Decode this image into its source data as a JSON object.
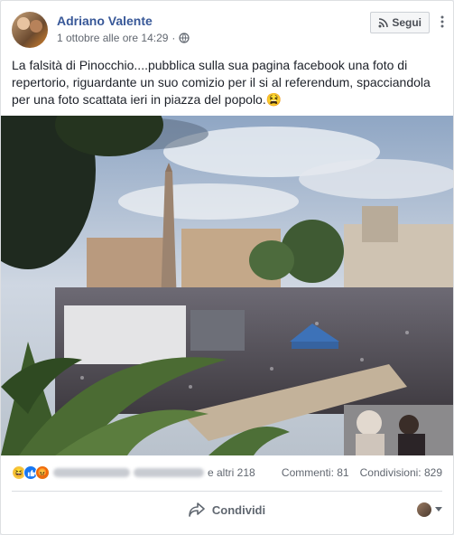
{
  "post": {
    "author": "Adriano Valente",
    "timestamp": "1 ottobre alle ore 14:29",
    "follow_label": "Segui",
    "text": "La falsità di Pinocchio....pubblica sulla sua pagina facebook una foto di repertorio, riguardante un suo comizio per il si al referendum, spacciandola per una foto scattata ieri in piazza del popolo.",
    "text_emoji": "😫"
  },
  "reactions": {
    "icons": [
      "haha-emoji",
      "like-icon",
      "angry-emoji"
    ],
    "others": "e altri 218",
    "comments": "Commenti: 81",
    "shares": "Condivisioni: 829"
  },
  "actions": {
    "share_label": "Condividi"
  },
  "colors": {
    "link_blue": "#385898",
    "like_blue": "#1877f2",
    "meta_gray": "#616770"
  }
}
